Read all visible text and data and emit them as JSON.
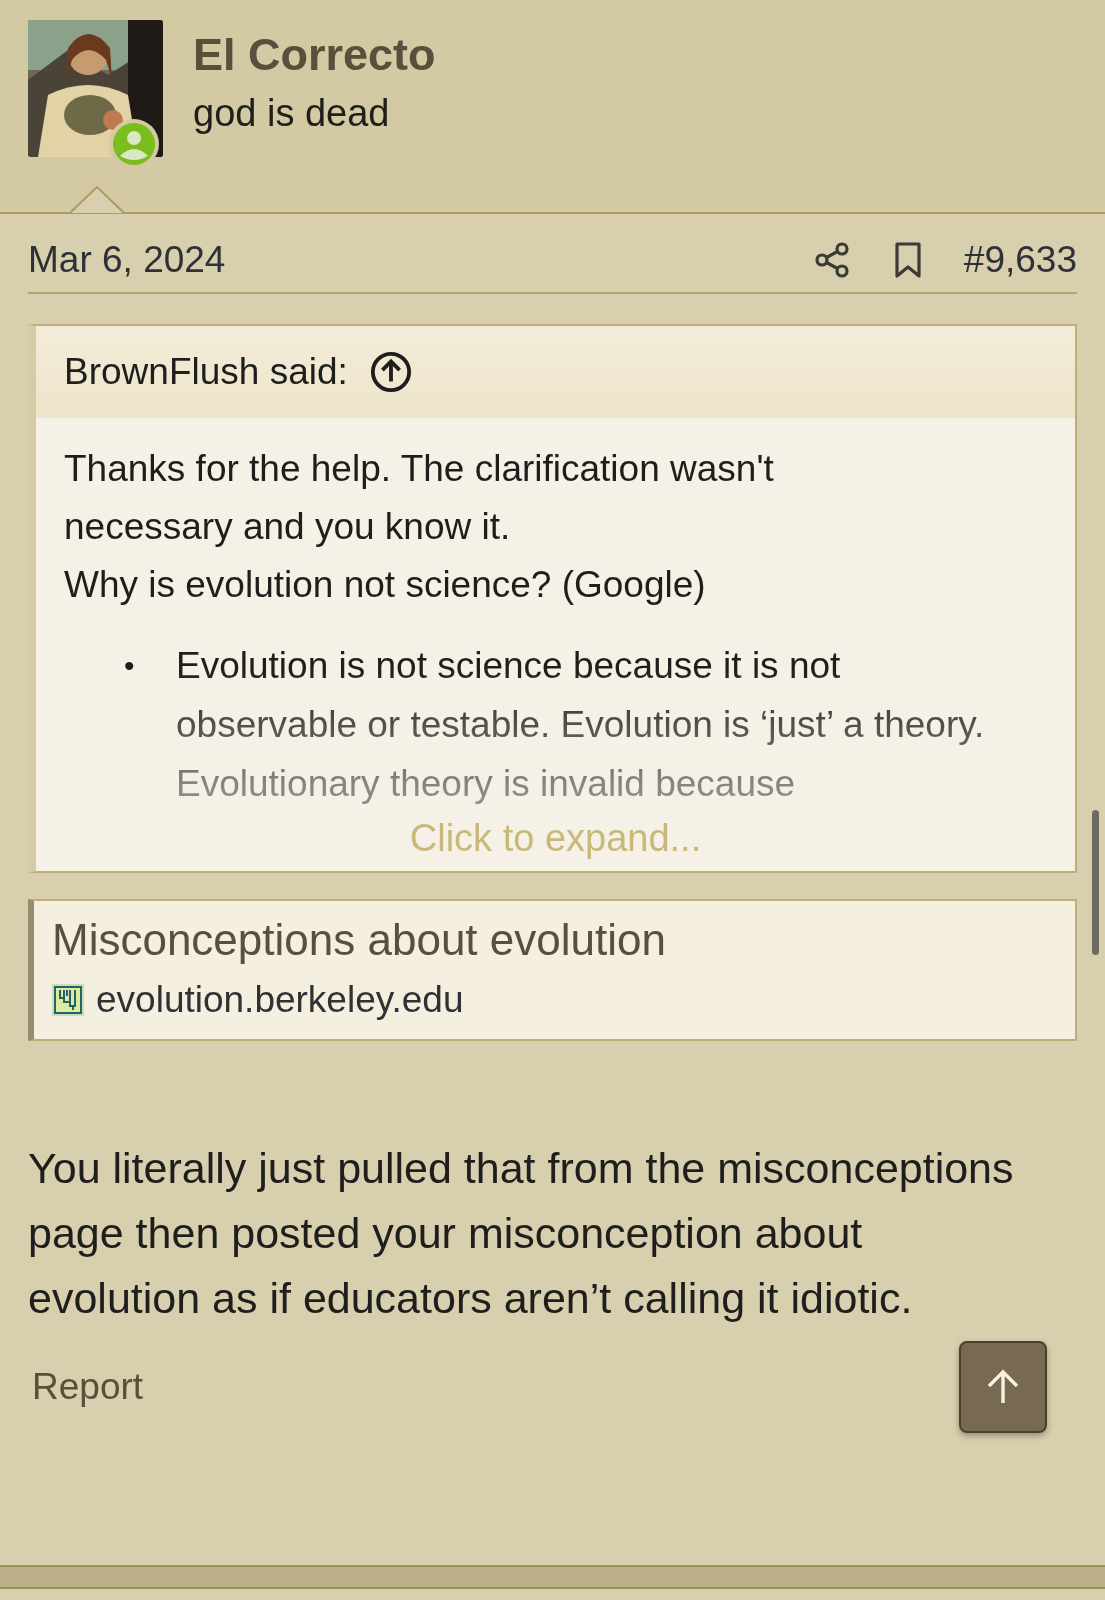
{
  "author": {
    "name": "El Correcto",
    "tagline": "god is dead",
    "online": true
  },
  "post": {
    "date": "Mar 6, 2024",
    "number": "#9,633",
    "quote": {
      "attribution": "BrownFlush said:",
      "lines": [
        "Thanks for the help. The clarification wasn't necessary and you know it.",
        "Why is evolution not science? (Google)"
      ],
      "bullets": [
        {
          "marker": "•",
          "text": "Evolution is not science because it is not observable or testable. Evolution is ‘just’ a theory. Evolutionary theory is invalid because"
        }
      ],
      "expand": "Click to expand..."
    },
    "link_card": {
      "title": "Misconceptions about evolution",
      "domain": "evolution.berkeley.edu"
    },
    "body": "You literally just pulled that from the misconceptions page then posted your misconception about evolution as if educators aren’t calling it idiotic.",
    "report": "Report"
  }
}
